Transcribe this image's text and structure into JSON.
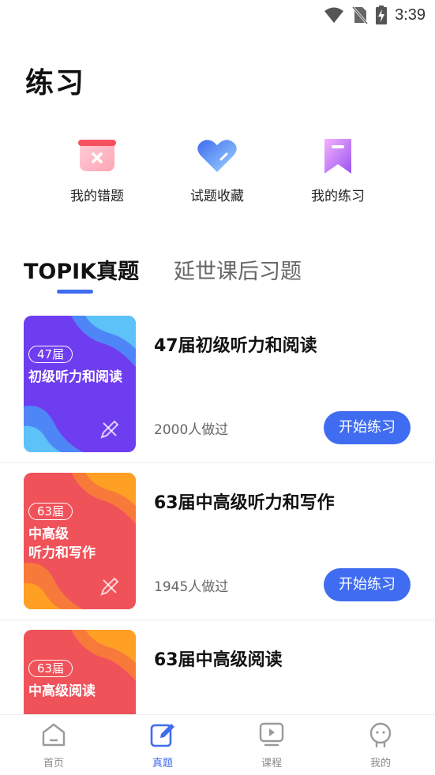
{
  "status_bar": {
    "time": "3:39"
  },
  "page": {
    "title": "练习"
  },
  "quick_actions": [
    {
      "label": "我的错题",
      "icon": "mistakes-icon"
    },
    {
      "label": "试题收藏",
      "icon": "favorites-icon"
    },
    {
      "label": "我的练习",
      "icon": "my-practice-icon"
    }
  ],
  "tabs": [
    {
      "label": "TOPIK真题",
      "active": true
    },
    {
      "label": "延世课后习题",
      "active": false
    }
  ],
  "exams": [
    {
      "title": "47届初级听力和阅读",
      "count_text": "2000人做过",
      "button_label": "开始练习",
      "cover": {
        "badge": "47届",
        "lines": [
          "初级听力和阅读"
        ],
        "theme": "purple",
        "colors": [
          "#6f3df0",
          "#55b9f8"
        ]
      }
    },
    {
      "title": "63届中高级听力和写作",
      "count_text": "1945人做过",
      "button_label": "开始练习",
      "cover": {
        "badge": "63届",
        "lines": [
          "中高级",
          "听力和写作"
        ],
        "theme": "red",
        "colors": [
          "#f0525a",
          "#ffa024"
        ]
      }
    },
    {
      "title": "63届中高级阅读",
      "count_text": "",
      "button_label": "",
      "cover": {
        "badge": "63届",
        "lines": [
          "中高级阅读"
        ],
        "theme": "red",
        "colors": [
          "#f0525a",
          "#ffa024"
        ]
      }
    }
  ],
  "bottom_nav": [
    {
      "label": "首页",
      "icon": "home-icon",
      "active": false
    },
    {
      "label": "真题",
      "icon": "exam-edit-icon",
      "active": true
    },
    {
      "label": "课程",
      "icon": "course-video-icon",
      "active": false
    },
    {
      "label": "我的",
      "icon": "profile-face-icon",
      "active": false
    }
  ],
  "colors": {
    "accent": "#3f6cf0",
    "text_primary": "#111111",
    "text_secondary": "#666666"
  }
}
